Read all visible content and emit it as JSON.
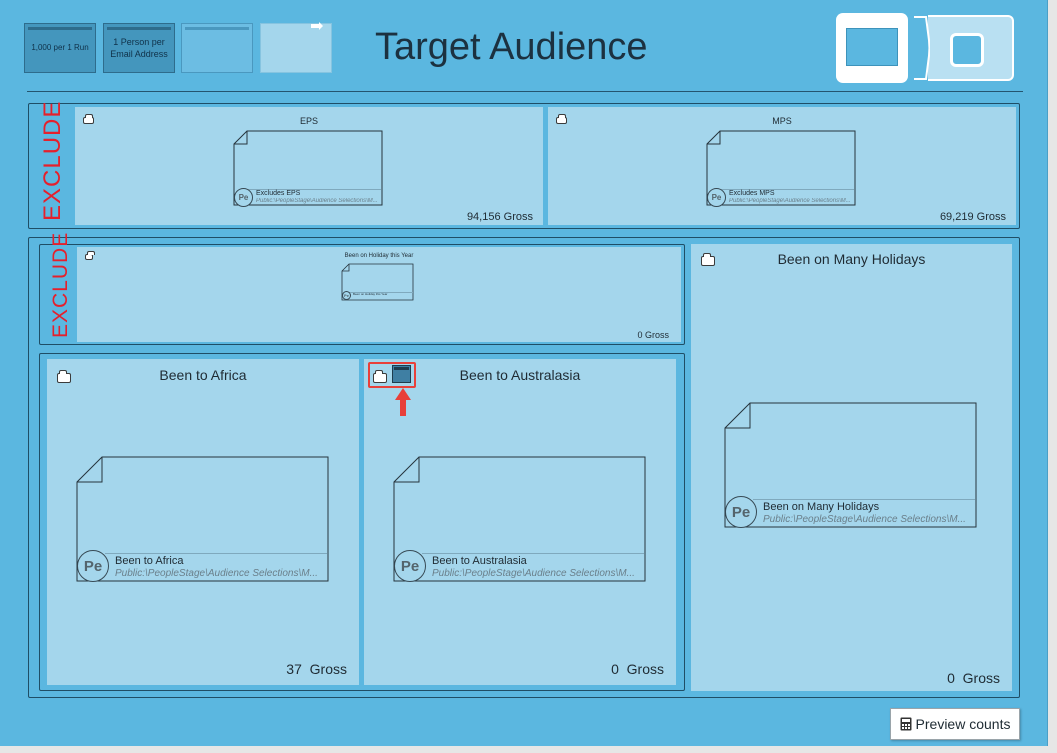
{
  "header": {
    "title": "Target Audience",
    "buttons": [
      {
        "label": "1,000 per 1 Run"
      },
      {
        "label": "1 Person per Email Address"
      },
      {
        "label": ""
      },
      {
        "label": ""
      }
    ]
  },
  "exclude_label": "EXCLUDE",
  "top_excludes": [
    {
      "title": "EPS",
      "doc_name": "Excludes EPS",
      "doc_path": "Public:\\PeopleStage\\Audience Selections\\M...",
      "gross": "94,156",
      "gross_label": "Gross"
    },
    {
      "title": "MPS",
      "doc_name": "Excludes MPS",
      "doc_path": "Public:\\PeopleStage\\Audience Selections\\M...",
      "gross": "69,219",
      "gross_label": "Gross"
    }
  ],
  "inner_exclude": {
    "title": "Been on Holiday this Year",
    "doc_name": "Been on Holiday this Year",
    "gross": "0",
    "gross_label": "Gross"
  },
  "panels": [
    {
      "title": "Been to Africa",
      "doc_name": "Been to Africa",
      "doc_path": "Public:\\PeopleStage\\Audience Selections\\M...",
      "gross": "37",
      "gross_label": "Gross"
    },
    {
      "title": "Been to Australasia",
      "doc_name": "Been to Australasia",
      "doc_path": "Public:\\PeopleStage\\Audience Selections\\M...",
      "gross": "0",
      "gross_label": "Gross"
    },
    {
      "title": "Been on Many Holidays",
      "doc_name": "Been on Many Holidays",
      "doc_path": "Public:\\PeopleStage\\Audience Selections\\M...",
      "gross": "0",
      "gross_label": "Gross"
    }
  ],
  "badge": "Pe",
  "preview": {
    "label": "Preview counts",
    "icon": "calculator-icon"
  },
  "colors": {
    "background": "#5bb7e0",
    "panel": "#a4d6ec",
    "exclude": "#e5202c",
    "highlight": "#e8403a"
  }
}
